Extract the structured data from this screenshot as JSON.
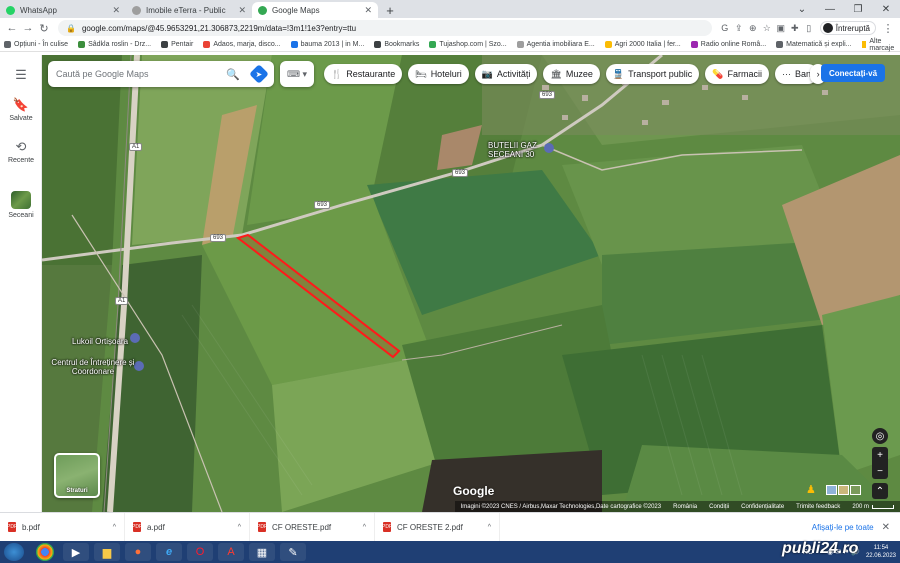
{
  "browser": {
    "tabs": [
      {
        "label": "WhatsApp",
        "color": "#25d366"
      },
      {
        "label": "Imobile eTerra - Public",
        "color": "#9e9e9e"
      },
      {
        "label": "Google Maps",
        "color": "#34a853"
      }
    ],
    "address": "google.com/maps/@45.9653291,21.306873,2219m/data=!3m1!1e3?entry=ttu",
    "profile_label": "Întreruptă",
    "bookmarks": [
      {
        "label": "Opțiuni - În culise",
        "color": "#5f6368"
      },
      {
        "label": "Sâdkla roslin - Drz...",
        "color": "#3c8e3c"
      },
      {
        "label": "Pentair",
        "color": "#3c4043"
      },
      {
        "label": "Adaos, marja, disco...",
        "color": "#ea4335"
      },
      {
        "label": "bauma 2013 | in M...",
        "color": "#1a73e8"
      },
      {
        "label": "Bookmarks",
        "color": "#3c4043"
      },
      {
        "label": "Tujashop.com | Szo...",
        "color": "#34a853"
      },
      {
        "label": "Agentia imobiliara E...",
        "color": "#9e9e9e"
      },
      {
        "label": "Agri 2000 Italia | fer...",
        "color": "#fbbc04"
      },
      {
        "label": "Radio online Româ...",
        "color": "#9c27b0"
      },
      {
        "label": "Matematică și expli...",
        "color": "#5f6368"
      }
    ],
    "other_bookmarks": "Alte marcaje"
  },
  "sidebar": {
    "menu_icon": "menu-icon",
    "items": [
      {
        "label": "Salvate",
        "icon": "bookmark-icon"
      },
      {
        "label": "Recente",
        "icon": "history-icon"
      },
      {
        "label": "Seceani",
        "icon": "place-thumbnail"
      }
    ]
  },
  "search": {
    "placeholder": "Caută pe Google Maps"
  },
  "chips": [
    {
      "label": "Restaurante",
      "icon": "🍴"
    },
    {
      "label": "Hoteluri",
      "icon": "🛏"
    },
    {
      "label": "Activități",
      "icon": "📷"
    },
    {
      "label": "Muzee",
      "icon": "🏛"
    },
    {
      "label": "Transport public",
      "icon": "🚆"
    },
    {
      "label": "Farmacii",
      "icon": "💊"
    },
    {
      "label": "Ban",
      "icon": "⋯"
    }
  ],
  "signin_label": "Conectați-vă",
  "map": {
    "labels": {
      "station_name": "BUTELII GAZ SECEANI 30",
      "lukoil": "Lukoil Ortișoara",
      "centre": "Centrul de Întreținere și Coordonare"
    },
    "roads": [
      "693",
      "693",
      "693",
      "693",
      "A1",
      "A1"
    ],
    "layers_label": "Straturi",
    "google_logo": "Google",
    "attribution": [
      "Imagini ©2023 CNES / Airbus,Maxar Technologies,Date cartografice ©2023",
      "România",
      "Condiții",
      "Confidențialitate",
      "Trimite feedback"
    ],
    "scale_label": "200 m"
  },
  "downloads": {
    "items": [
      "b.pdf",
      "a.pdf",
      "CF ORESTE.pdf",
      "CF ORESTE 2.pdf"
    ],
    "show_all": "Afișați-le pe toate"
  },
  "taskbar": {
    "lang": "RO",
    "time": "11:54",
    "date": "22.06.2023"
  },
  "watermark": "publi24.ro"
}
